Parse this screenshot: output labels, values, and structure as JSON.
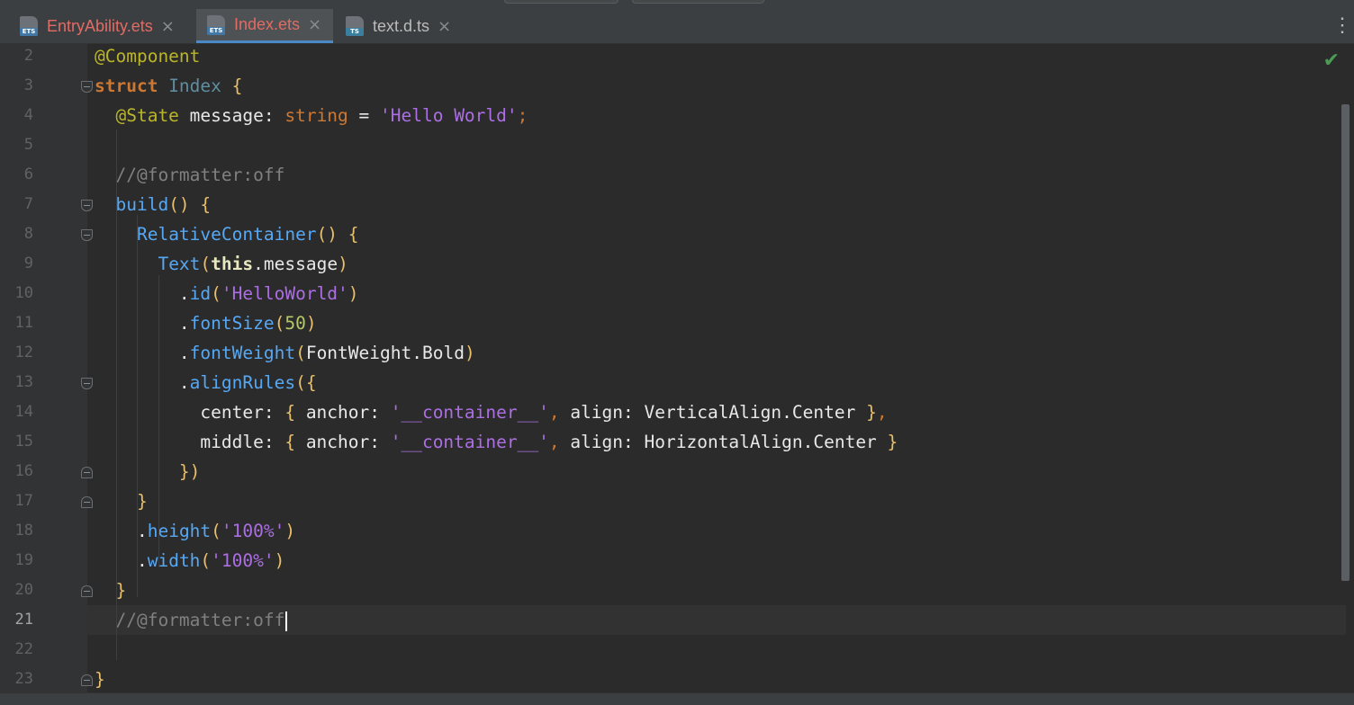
{
  "tabs": [
    {
      "label": "EntryAbility.ets",
      "icon": "ETS",
      "close": "×",
      "color": "#e06c65",
      "active": false
    },
    {
      "label": "Index.ets",
      "icon": "ETS",
      "close": "×",
      "color": "#e06c65",
      "active": true
    },
    {
      "label": "text.d.ts",
      "icon": "TS",
      "close": "×",
      "color": "#bbbbbb",
      "active": false
    }
  ],
  "tab_menu_icon": "more-vertical-icon",
  "inspection_icon": "check-icon",
  "colors": {
    "background": "#2b2b2b",
    "gutter": "#313335",
    "keyword": "#cc7832",
    "decorator": "#bbb529",
    "string": "#ab6fe3",
    "function": "#56a8f5",
    "class_name": "#56a8f5",
    "comment": "#808080",
    "number": "#6897bb",
    "default": "#a9b7c6",
    "bracket": "#e8bf6a",
    "success": "#499c54"
  },
  "editor": {
    "current_line": "21",
    "lines": [
      {
        "num": "2",
        "fold": "",
        "tokens": [
          {
            "t": "@Component",
            "c": "#bbb529"
          }
        ]
      },
      {
        "num": "3",
        "fold": "open",
        "tokens": [
          {
            "t": "struct ",
            "c": "#cc7832",
            "b": true
          },
          {
            "t": "Index ",
            "c": "#5f8ea0"
          },
          {
            "t": "{",
            "c": "#e8bf6a"
          }
        ]
      },
      {
        "num": "4",
        "fold": "",
        "tokens": [
          {
            "t": "  "
          },
          {
            "t": "@State ",
            "c": "#bbb529"
          },
          {
            "t": "message: ",
            "c": "#e8e8e8"
          },
          {
            "t": "string ",
            "c": "#cc7832"
          },
          {
            "t": "= ",
            "c": "#e8e8e8"
          },
          {
            "t": "'Hello World'",
            "c": "#ab6fe3"
          },
          {
            "t": ";",
            "c": "#cc7832"
          }
        ]
      },
      {
        "num": "5",
        "fold": "",
        "tokens": []
      },
      {
        "num": "6",
        "fold": "",
        "tokens": [
          {
            "t": "  "
          },
          {
            "t": "//@formatter:off",
            "c": "#808080"
          }
        ]
      },
      {
        "num": "7",
        "fold": "open",
        "tokens": [
          {
            "t": "  "
          },
          {
            "t": "build",
            "c": "#56a8f5"
          },
          {
            "t": "() ",
            "c": "#e8bf6a"
          },
          {
            "t": "{",
            "c": "#e8bf6a"
          }
        ]
      },
      {
        "num": "8",
        "fold": "open",
        "tokens": [
          {
            "t": "    "
          },
          {
            "t": "RelativeContainer",
            "c": "#56a8f5"
          },
          {
            "t": "() ",
            "c": "#e8bf6a"
          },
          {
            "t": "{",
            "c": "#e8bf6a"
          }
        ]
      },
      {
        "num": "9",
        "fold": "",
        "tokens": [
          {
            "t": "      "
          },
          {
            "t": "Text",
            "c": "#56a8f5"
          },
          {
            "t": "(",
            "c": "#e8bf6a"
          },
          {
            "t": "this",
            "c": "#e8e8c0",
            "b": true
          },
          {
            "t": ".message",
            "c": "#e8e8e8"
          },
          {
            "t": ")",
            "c": "#e8bf6a"
          }
        ]
      },
      {
        "num": "10",
        "fold": "",
        "tokens": [
          {
            "t": "        "
          },
          {
            "t": ".",
            "c": "#e8e8e8"
          },
          {
            "t": "id",
            "c": "#56a8f5"
          },
          {
            "t": "(",
            "c": "#e8bf6a"
          },
          {
            "t": "'HelloWorld'",
            "c": "#ab6fe3"
          },
          {
            "t": ")",
            "c": "#e8bf6a"
          }
        ]
      },
      {
        "num": "11",
        "fold": "",
        "tokens": [
          {
            "t": "        "
          },
          {
            "t": ".",
            "c": "#e8e8e8"
          },
          {
            "t": "fontSize",
            "c": "#56a8f5"
          },
          {
            "t": "(",
            "c": "#e8bf6a"
          },
          {
            "t": "50",
            "c": "#b5c966"
          },
          {
            "t": ")",
            "c": "#e8bf6a"
          }
        ]
      },
      {
        "num": "12",
        "fold": "",
        "tokens": [
          {
            "t": "        "
          },
          {
            "t": ".",
            "c": "#e8e8e8"
          },
          {
            "t": "fontWeight",
            "c": "#56a8f5"
          },
          {
            "t": "(",
            "c": "#e8bf6a"
          },
          {
            "t": "FontWeight.Bold",
            "c": "#e8e8e8"
          },
          {
            "t": ")",
            "c": "#e8bf6a"
          }
        ]
      },
      {
        "num": "13",
        "fold": "open",
        "tokens": [
          {
            "t": "        "
          },
          {
            "t": ".",
            "c": "#e8e8e8"
          },
          {
            "t": "alignRules",
            "c": "#56a8f5"
          },
          {
            "t": "(",
            "c": "#e8bf6a"
          },
          {
            "t": "{",
            "c": "#e8bf6a"
          }
        ]
      },
      {
        "num": "14",
        "fold": "",
        "tokens": [
          {
            "t": "          "
          },
          {
            "t": "center: ",
            "c": "#e8e8e8"
          },
          {
            "t": "{ ",
            "c": "#e8bf6a"
          },
          {
            "t": "anchor: ",
            "c": "#e8e8e8"
          },
          {
            "t": "'__container__'",
            "c": "#ab6fe3"
          },
          {
            "t": ", ",
            "c": "#cc7832"
          },
          {
            "t": "align: ",
            "c": "#e8e8e8"
          },
          {
            "t": "VerticalAlign.Center ",
            "c": "#e8e8e8"
          },
          {
            "t": "}",
            "c": "#e8bf6a"
          },
          {
            "t": ",",
            "c": "#cc7832"
          }
        ]
      },
      {
        "num": "15",
        "fold": "",
        "tokens": [
          {
            "t": "          "
          },
          {
            "t": "middle: ",
            "c": "#e8e8e8"
          },
          {
            "t": "{ ",
            "c": "#e8bf6a"
          },
          {
            "t": "anchor: ",
            "c": "#e8e8e8"
          },
          {
            "t": "'__container__'",
            "c": "#ab6fe3"
          },
          {
            "t": ", ",
            "c": "#cc7832"
          },
          {
            "t": "align: ",
            "c": "#e8e8e8"
          },
          {
            "t": "HorizontalAlign.Center ",
            "c": "#e8e8e8"
          },
          {
            "t": "}",
            "c": "#e8bf6a"
          }
        ]
      },
      {
        "num": "16",
        "fold": "close",
        "tokens": [
          {
            "t": "        "
          },
          {
            "t": "}",
            "c": "#e8bf6a"
          },
          {
            "t": ")",
            "c": "#e8bf6a"
          }
        ]
      },
      {
        "num": "17",
        "fold": "close",
        "tokens": [
          {
            "t": "    "
          },
          {
            "t": "}",
            "c": "#e8bf6a"
          }
        ]
      },
      {
        "num": "18",
        "fold": "",
        "tokens": [
          {
            "t": "    "
          },
          {
            "t": ".",
            "c": "#e8e8e8"
          },
          {
            "t": "height",
            "c": "#56a8f5"
          },
          {
            "t": "(",
            "c": "#e8bf6a"
          },
          {
            "t": "'100%'",
            "c": "#ab6fe3"
          },
          {
            "t": ")",
            "c": "#e8bf6a"
          }
        ]
      },
      {
        "num": "19",
        "fold": "",
        "tokens": [
          {
            "t": "    "
          },
          {
            "t": ".",
            "c": "#e8e8e8"
          },
          {
            "t": "width",
            "c": "#56a8f5"
          },
          {
            "t": "(",
            "c": "#e8bf6a"
          },
          {
            "t": "'100%'",
            "c": "#ab6fe3"
          },
          {
            "t": ")",
            "c": "#e8bf6a"
          }
        ]
      },
      {
        "num": "20",
        "fold": "close",
        "tokens": [
          {
            "t": "  "
          },
          {
            "t": "}",
            "c": "#e8bf6a"
          }
        ]
      },
      {
        "num": "21",
        "fold": "",
        "caret": true,
        "tokens": [
          {
            "t": "  "
          },
          {
            "t": "//@formatter:off",
            "c": "#808080"
          }
        ]
      },
      {
        "num": "22",
        "fold": "",
        "tokens": []
      },
      {
        "num": "23",
        "fold": "close",
        "tokens": [
          {
            "t": "}",
            "c": "#e8bf6a"
          }
        ]
      }
    ]
  }
}
